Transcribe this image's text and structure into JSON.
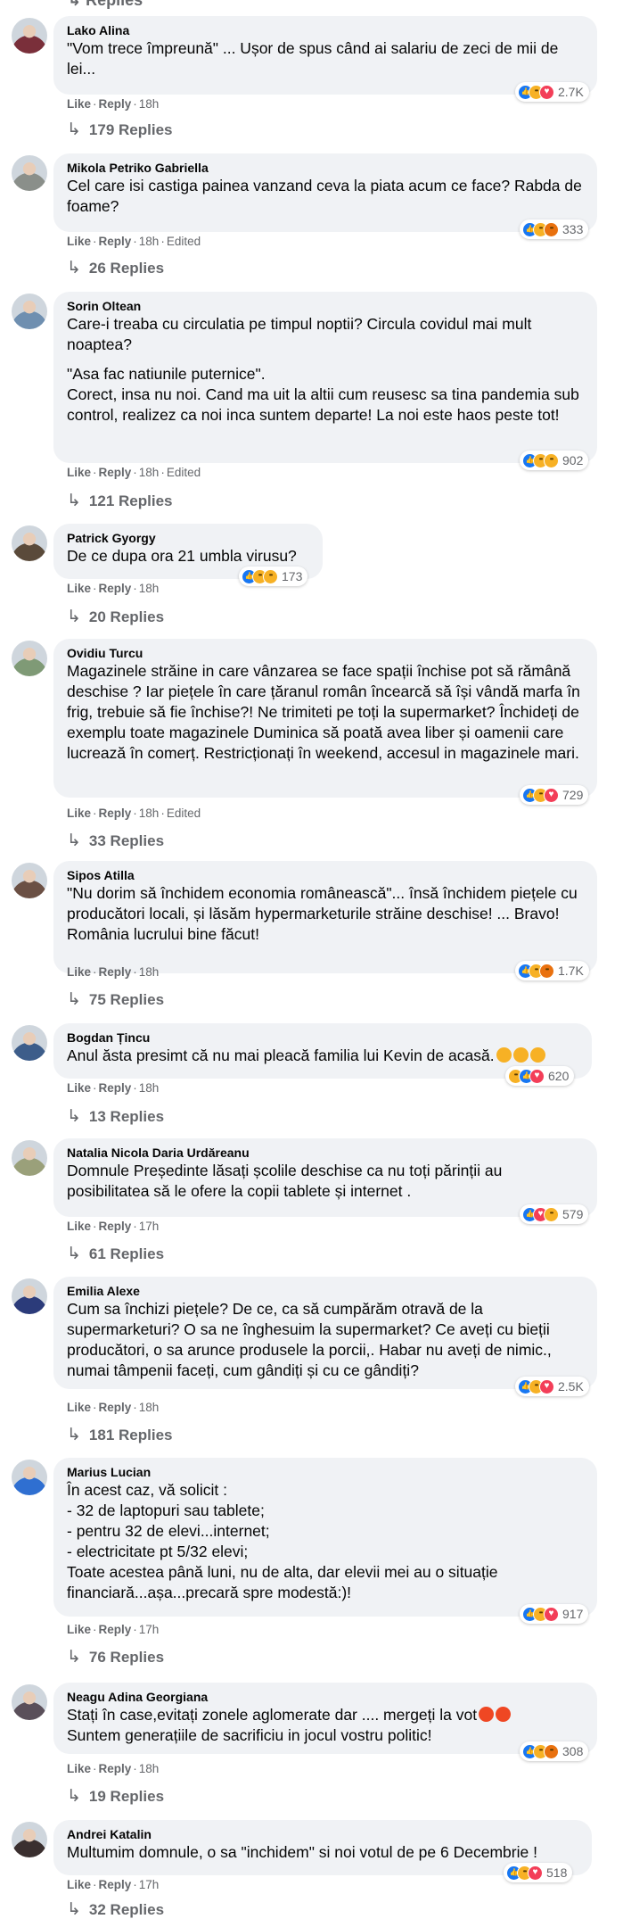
{
  "top_cut_text": "Replies",
  "comments": [
    {
      "name": "Lako Alina",
      "lines": [
        "\"Vom trece împreună\" ... Ușor de spus când ai salariu de zeci de mii de lei..."
      ],
      "actions": {
        "like": "Like",
        "reply": "Reply",
        "time": "18h",
        "edited": ""
      },
      "reactions": {
        "icons": [
          "like-icon",
          "haha-icon",
          "love-icon"
        ],
        "count": "2.7K"
      },
      "replies": "179 Replies",
      "avatar_color": "#7a2f3a"
    },
    {
      "name": "Mikola Petriko Gabriella",
      "lines": [
        "Cel care isi castiga painea vanzand ceva la piata acum ce face? Rabda de foame?"
      ],
      "actions": {
        "like": "Like",
        "reply": "Reply",
        "time": "18h",
        "edited": "Edited"
      },
      "reactions": {
        "icons": [
          "like-icon",
          "sad-icon",
          "angry-icon"
        ],
        "count": "333"
      },
      "replies": "26 Replies",
      "avatar_color": "#8a8f8a"
    },
    {
      "name": "Sorin Oltean",
      "lines": [
        "Care-i treaba cu circulatia pe timpul noptii? Circula covidul mai mult noaptea?",
        "\"Asa fac natiunile puternice\".\nCorect, insa nu noi. Cand ma uit la altii cum reusesc sa tina pandemia sub control, realizez ca noi inca suntem departe! La noi este haos peste tot!"
      ],
      "actions": {
        "like": "Like",
        "reply": "Reply",
        "time": "18h",
        "edited": "Edited"
      },
      "reactions": {
        "icons": [
          "like-icon",
          "haha-icon",
          "sad-icon"
        ],
        "count": "902"
      },
      "replies": "121 Replies",
      "avatar_color": "#6f8fb0"
    },
    {
      "name": "Patrick Gyorgy",
      "lines": [
        "De ce dupa ora 21 umbla virusu?"
      ],
      "actions": {
        "like": "Like",
        "reply": "Reply",
        "time": "18h",
        "edited": ""
      },
      "reactions": {
        "icons": [
          "like-icon",
          "haha-icon",
          "wow-icon"
        ],
        "count": "173"
      },
      "replies": "20 Replies",
      "avatar_color": "#5a4a3a"
    },
    {
      "name": "Ovidiu Turcu",
      "lines": [
        "Magazinele străine in care vânzarea se face spații închise pot să rămână deschise ? Iar piețele în care țăranul român încearcă să își vândă marfa în frig, trebuie să fie închise?! Ne trimiteti pe toți la supermarket? Închideți de exemplu toate magazinele Duminica să poată avea liber și oamenii care lucrează în comerț. Restricționați în weekend, accesul in magazinele mari."
      ],
      "actions": {
        "like": "Like",
        "reply": "Reply",
        "time": "18h",
        "edited": "Edited"
      },
      "reactions": {
        "icons": [
          "like-icon",
          "sad-icon",
          "love-icon"
        ],
        "count": "729"
      },
      "replies": "33 Replies",
      "avatar_color": "#7f9a76"
    },
    {
      "name": "Sipos Atilla",
      "lines": [
        "\"Nu dorim să închidem economia românească\"... însă închidem piețele cu producători locali, și lăsăm hypermarketurile străine deschise! ... Bravo! România lucrului bine făcut!"
      ],
      "actions": {
        "like": "Like",
        "reply": "Reply",
        "time": "18h",
        "edited": ""
      },
      "reactions": {
        "icons": [
          "like-icon",
          "sad-icon",
          "angry-icon"
        ],
        "count": "1.7K"
      },
      "replies": "75 Replies",
      "avatar_color": "#6b5044"
    },
    {
      "name": "Bogdan Țincu",
      "lines": [
        "Anul ăsta presimt că nu mai pleacă familia lui Kevin de acasă."
      ],
      "actions": {
        "like": "Like",
        "reply": "Reply",
        "time": "18h",
        "edited": ""
      },
      "reactions": {
        "icons": [
          "haha-icon",
          "like-icon",
          "love-icon"
        ],
        "count": "620"
      },
      "replies": "13 Replies",
      "avatar_color": "#3d5d8a"
    },
    {
      "name": "Natalia Nicola Daria Urdăreanu",
      "lines": [
        "Domnule Președinte lăsați școlile deschise ca nu toți părinții au posibilitatea să le ofere la copii tablete și internet ."
      ],
      "actions": {
        "like": "Like",
        "reply": "Reply",
        "time": "17h",
        "edited": ""
      },
      "reactions": {
        "icons": [
          "like-icon",
          "love-icon",
          "sad-icon"
        ],
        "count": "579"
      },
      "replies": "61 Replies",
      "avatar_color": "#9aa07a"
    },
    {
      "name": "Emilia Alexe",
      "lines": [
        "Cum sa închizi piețele? De ce, ca să cumpărăm otravă de la supermarketuri? O sa ne înghesuim la supermarket? Ce aveți cu bieții producători, o sa arunce produsele la porcii,. Habar nu aveți de nimic., numai tâmpenii faceți, cum gândiți și cu ce gândiți?"
      ],
      "actions": {
        "like": "Like",
        "reply": "Reply",
        "time": "18h",
        "edited": ""
      },
      "reactions": {
        "icons": [
          "like-icon",
          "sad-icon",
          "love-icon"
        ],
        "count": "2.5K"
      },
      "replies": "181 Replies",
      "avatar_color": "#2b3b7a"
    },
    {
      "name": "Marius Lucian",
      "lines": [
        "În acest caz, vă solicit :\n- 32 de laptopuri sau tablete;\n- pentru 32 de elevi...internet;\n- electricitate pt 5/32 elevi;\nToate acestea până luni, nu de alta, dar elevii mei au o situație financiară...așa...precară spre modestă:)!"
      ],
      "actions": {
        "like": "Like",
        "reply": "Reply",
        "time": "17h",
        "edited": ""
      },
      "reactions": {
        "icons": [
          "like-icon",
          "sad-icon",
          "love-icon"
        ],
        "count": "917"
      },
      "replies": "76 Replies",
      "avatar_color": "#2f6fd1"
    },
    {
      "name": "Neagu Adina Georgiana",
      "lines": [
        "Stați în case,evitați zonele aglomerate dar .... mergeți la vot\nSuntem generațiile de sacrificiu in jocul vostru politic!"
      ],
      "actions": {
        "like": "Like",
        "reply": "Reply",
        "time": "18h",
        "edited": ""
      },
      "reactions": {
        "icons": [
          "like-icon",
          "sad-icon",
          "angry-icon"
        ],
        "count": "308"
      },
      "replies": "19 Replies",
      "avatar_color": "#5a4f5a"
    },
    {
      "name": "Andrei Katalin",
      "lines": [
        "Multumim domnule, o sa \"inchidem\" si noi votul de pe 6 Decembrie !"
      ],
      "actions": {
        "like": "Like",
        "reply": "Reply",
        "time": "17h",
        "edited": ""
      },
      "reactions": {
        "icons": [
          "like-icon",
          "haha-icon",
          "love-icon"
        ],
        "count": "518"
      },
      "replies": "32 Replies",
      "avatar_color": "#3a2f2f"
    }
  ]
}
